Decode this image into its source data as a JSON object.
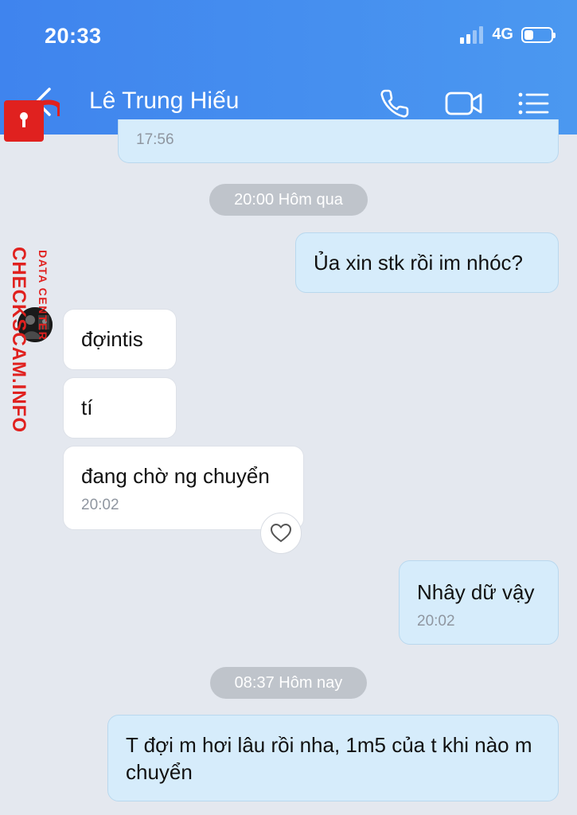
{
  "status_bar": {
    "time": "20:33",
    "network": "4G"
  },
  "header": {
    "contact_name": "Lê Trung Hiếu"
  },
  "watermark": {
    "main": "CHECKSCAM.INFO",
    "sub": "DATA CENTER"
  },
  "messages": {
    "m0": {
      "time": "17:56"
    },
    "sep1": "20:00 Hôm qua",
    "m1": {
      "text": "Ủa xin stk rồi im nhóc?"
    },
    "m2": {
      "text": "đợintis"
    },
    "m3": {
      "text": "tí"
    },
    "m4": {
      "text": "đang chờ ng chuyển",
      "time": "20:02"
    },
    "m5": {
      "text": "Nhây dữ vậy",
      "time": "20:02"
    },
    "sep2": "08:37 Hôm nay",
    "m6": {
      "text": "T đợi m hơi lâu rồi nha, 1m5 của t khi nào m chuyển"
    }
  },
  "colors": {
    "header": "#3f84ee",
    "sent_bubble": "#d6ecfb",
    "received_bubble": "#ffffff",
    "background": "#e4e8ef",
    "watermark": "#e0211f"
  }
}
